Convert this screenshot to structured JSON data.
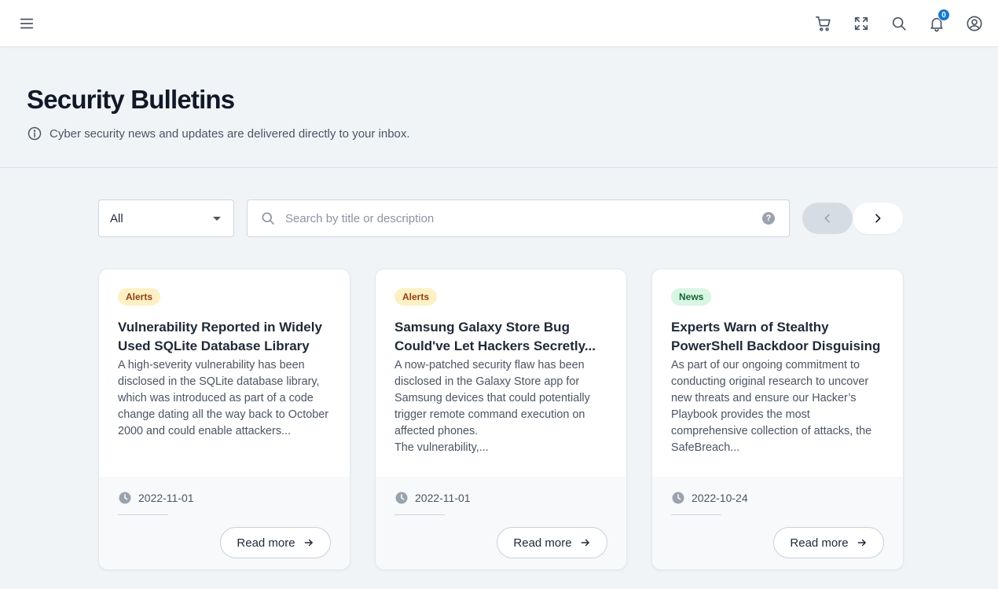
{
  "topbar": {
    "icons": [
      "menu-icon",
      "cart-icon",
      "fullscreen-icon",
      "search-icon",
      "bell-icon",
      "account-circle-icon"
    ],
    "notification_count": "0"
  },
  "header": {
    "title": "Security Bulletins",
    "subtitle": "Cyber security news and updates are delivered directly to your inbox."
  },
  "filters": {
    "category_selected": "All",
    "search_placeholder": "Search by title or description",
    "search_value": "",
    "help_label": "?"
  },
  "colors": {
    "alerts_tag_bg": "#fdf0c4",
    "news_tag_bg": "#d9f5e4",
    "badge": "#1677d2"
  },
  "cards": [
    {
      "tag": "Alerts",
      "title": "Vulnerability Reported in Widely Used SQLite Database Library",
      "description": "A high-severity vulnerability has been disclosed in the SQLite database library, which was introduced as part of a code change dating all the way back to October 2000 and could enable attackers...",
      "date": "2022-11-01",
      "button": "Read more"
    },
    {
      "tag": "Alerts",
      "title": "Samsung Galaxy Store Bug Could've Let Hackers Secretly...",
      "description": "A now-patched security flaw has been disclosed in the Galaxy Store app for Samsung devices that could potentially trigger remote command execution on affected phones.\nThe vulnerability,...",
      "date": "2022-11-01",
      "button": "Read more"
    },
    {
      "tag": "News",
      "title": "Experts Warn of Stealthy PowerShell Backdoor Disguising ...",
      "description": "As part of our ongoing commitment to conducting original research to uncover new threats and ensure our Hacker’s Playbook provides the most comprehensive collection of attacks, the SafeBreach...",
      "date": "2022-10-24",
      "button": "Read more"
    }
  ]
}
